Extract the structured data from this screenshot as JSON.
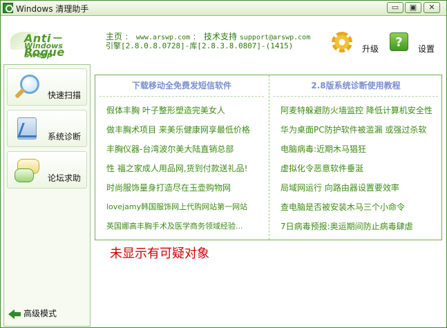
{
  "window": {
    "title": "Windows 清理助手",
    "buttons": {
      "minimize": "▭",
      "maximize": "▣",
      "close": "✕"
    }
  },
  "header": {
    "logo_line1": "Anti－Rogue",
    "logo_line2": "Windows Sweep",
    "home_label": "主页",
    "home_url": "www.arswp.com",
    "support_label": "技术支持",
    "support_email": "support@arswp.com",
    "engine_line": "引擎[2.8.0.8.0728]-库[2.8.3.8.0807]-(1415)",
    "upgrade_label": "升级",
    "settings_label": "设置",
    "settings_icon_text": "?"
  },
  "sidebar": {
    "items": [
      {
        "label": "快速扫描",
        "icon": "magnifier-icon"
      },
      {
        "label": "系统诊断",
        "icon": "diagnose-icon"
      },
      {
        "label": "论坛求助",
        "icon": "forum-icon"
      }
    ],
    "advanced_label": "高级模式"
  },
  "news": {
    "left_header": "下载移动全免费发短信软件",
    "right_header": "2.8版系统诊断使用教程",
    "left_links": [
      "假体丰胸 叶子整形塑造完美女人",
      "做丰胸术项目 来美乐健康网享最低价格",
      "丰胸仪器-台湾波尔美大陆直销总部",
      "性 福之家成人用品网,货到付款送礼品!",
      "时尚服饰量身打造尽在玉壶购物网",
      "lovejamy韩国服饰网上代购网站第一网站",
      "英国娜高丰胸手术及医学商务领域经验..."
    ],
    "right_links": [
      "阿麦特躲避防火墙监控 降低计算机安全性",
      "华为桌面PC防护软件被滥漏 或强过杀软",
      "电脑病毒:近期木马猖狂",
      "虚拟化令恶意软件垂涎",
      "局域网运行 向路由器设置要效率",
      "查电脑是否被安装木马三个小命令",
      "7日病毒预报:奥运期间防止病毒肆虐"
    ]
  },
  "status": {
    "message": "未显示有可疑对象"
  },
  "colors": {
    "accent_green": "#3c8c14",
    "header_blue": "#7b8fd1",
    "status_red": "#d00000"
  }
}
